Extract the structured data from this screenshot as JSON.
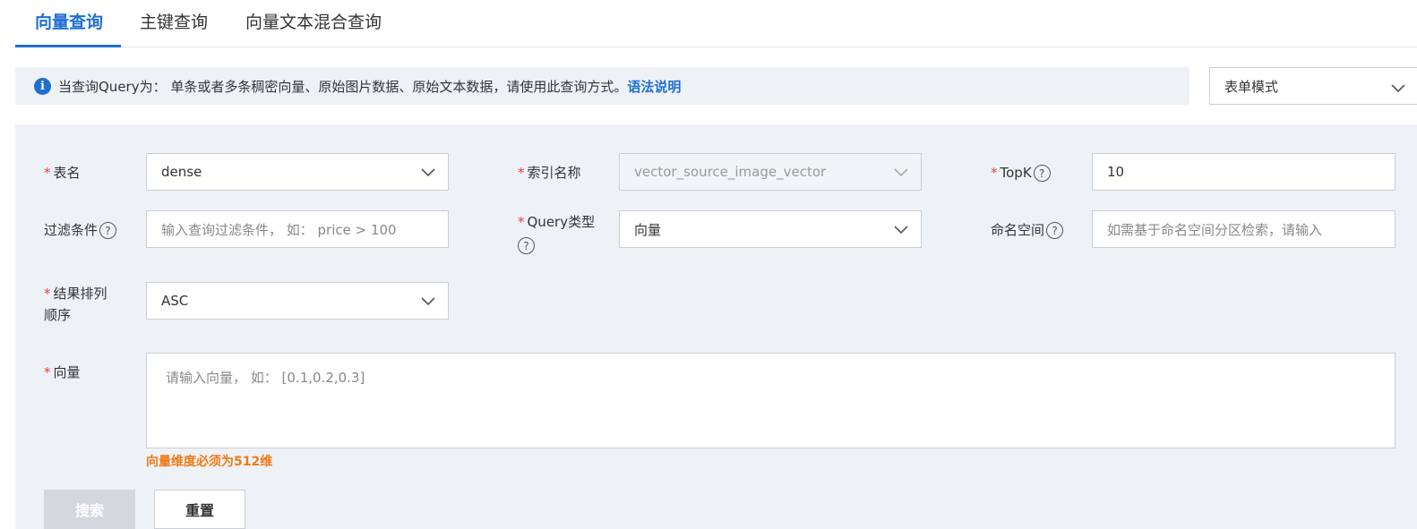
{
  "tabs": [
    "向量查询",
    "主键查询",
    "向量文本混合查询"
  ],
  "notice": {
    "text": "当查询Query为： 单条或者多条稠密向量、原始图片数据、原始文本数据，请使用此查询方式。",
    "link": "语法说明"
  },
  "mode_select": {
    "value": "表单模式"
  },
  "form": {
    "table_name": {
      "label": "表名",
      "value": "dense"
    },
    "index_name": {
      "label": "索引名称",
      "value": "vector_source_image_vector"
    },
    "topk": {
      "label": "TopK",
      "value": "10"
    },
    "filter": {
      "label": "过滤条件",
      "placeholder": "输入查询过滤条件， 如：  price > 100"
    },
    "query_type": {
      "label": "Query类型",
      "value": "向量"
    },
    "namespace": {
      "label": "命名空间",
      "placeholder": "如需基于命名空间分区检索，请输入"
    },
    "sort_order": {
      "label_line1": "结果排列",
      "label_line2": "顺序",
      "value": "ASC"
    },
    "vector": {
      "label": "向量",
      "placeholder": "请输入向量， 如：  [0.1,0.2,0.3]"
    },
    "error": "向量维度必须为512维"
  },
  "buttons": {
    "search": "搜索",
    "reset": "重置"
  },
  "icons": {
    "info": "info-icon",
    "help": "help-circle-icon",
    "chevron": "chevron-down-icon"
  },
  "colors": {
    "accent": "#1f6fd1",
    "required": "#e0452b",
    "error": "#f07a12",
    "panel_bg": "#eef2f7"
  }
}
